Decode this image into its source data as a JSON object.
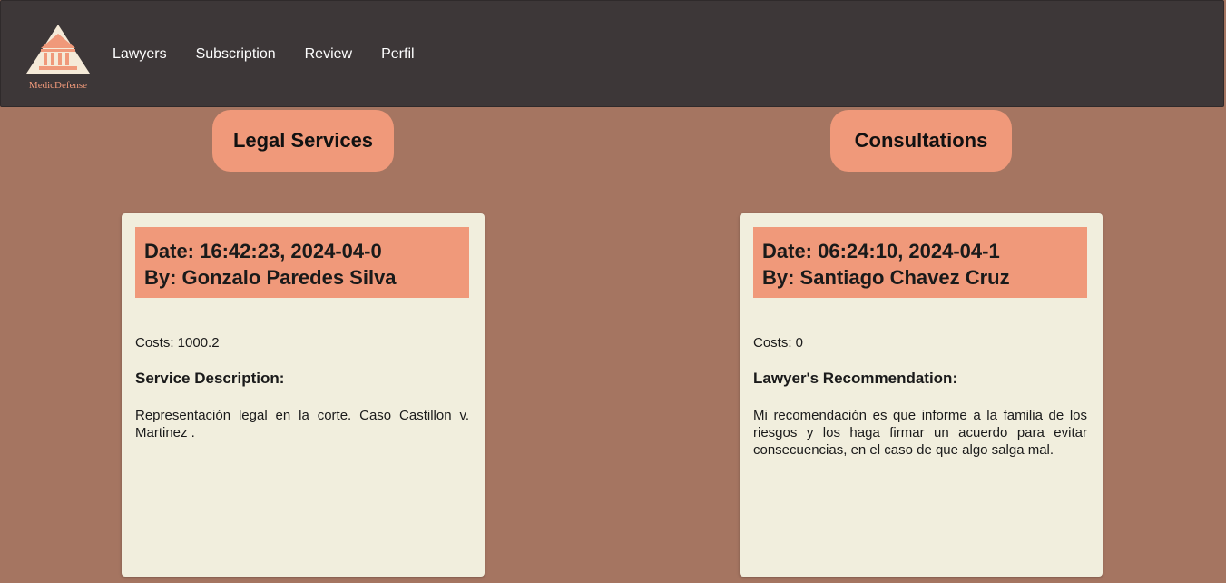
{
  "brand": {
    "name": "MedicDefense"
  },
  "nav": {
    "items": [
      {
        "label": "Lawyers"
      },
      {
        "label": "Subscription"
      },
      {
        "label": "Review"
      },
      {
        "label": "Perfil"
      }
    ]
  },
  "colors": {
    "topbar": "#3d3738",
    "background": "#a57561",
    "accent": "#f0997a",
    "card": "#f1eedd"
  },
  "legal_services": {
    "title": "Legal Services",
    "card": {
      "date": "Date: 16:42:23, 2024-04-0",
      "by": "By: Gonzalo Paredes Silva",
      "costs": "Costs: 1000.2",
      "section_title": "Service Description:",
      "text": "Representación legal en la corte. Caso Castillon v. Martinez ."
    }
  },
  "consultations": {
    "title": "Consultations",
    "card": {
      "date": "Date: 06:24:10, 2024-04-1",
      "by": "By: Santiago Chavez Cruz",
      "costs": "Costs: 0",
      "section_title": "Lawyer's Recommendation:",
      "text": "Mi recomendación es que informe a la familia de los riesgos y los haga firmar un acuerdo para evitar consecuencias, en el caso de que algo salga mal."
    }
  }
}
